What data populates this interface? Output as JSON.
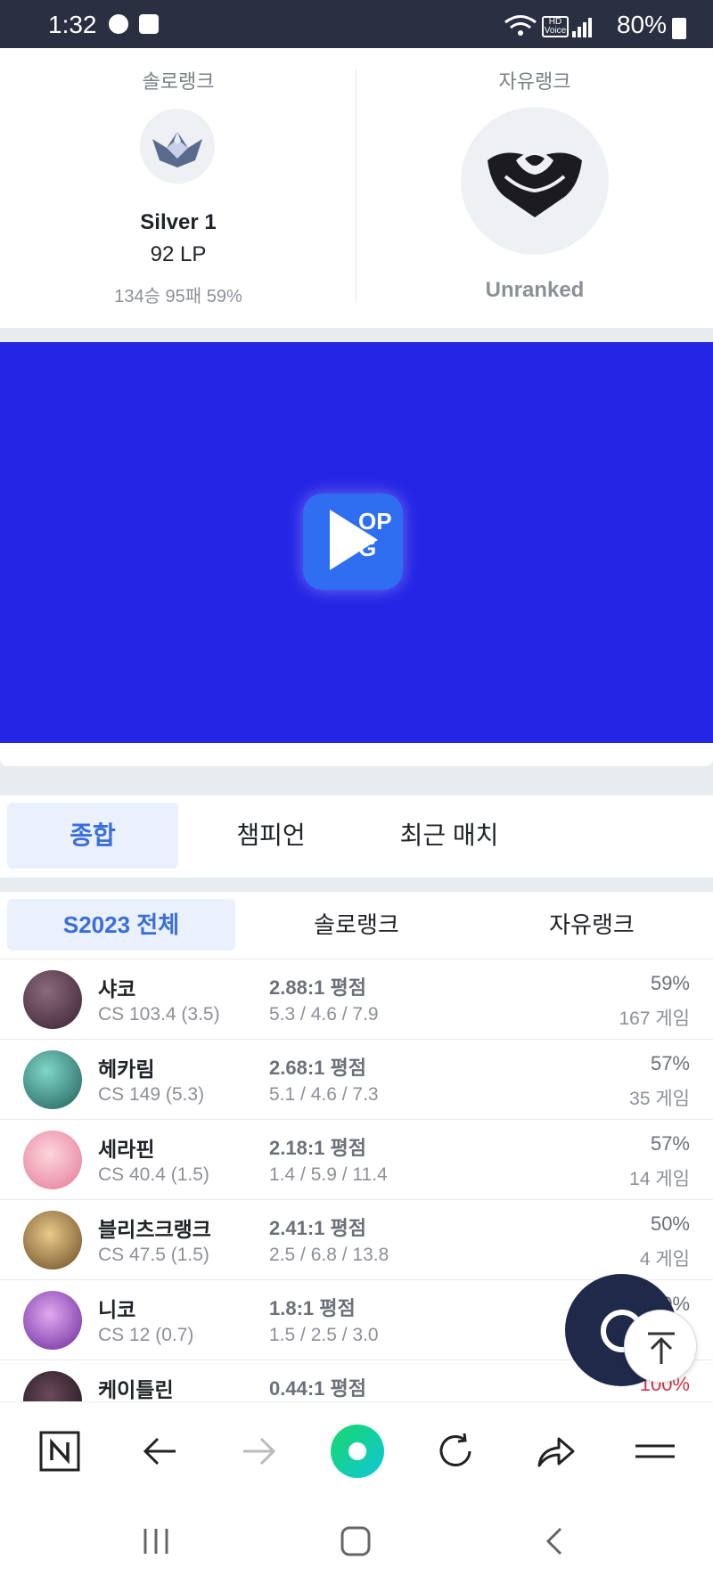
{
  "status_bar": {
    "time": "1:32",
    "battery": "80%",
    "hd_label": "HD Voice"
  },
  "rank": {
    "solo": {
      "title": "솔로랭크",
      "tier": "Silver 1",
      "lp": "92 LP",
      "record": "134승 95패 59%"
    },
    "flex": {
      "title": "자유랭크",
      "tier": "Unranked"
    }
  },
  "ad": {
    "letters": "OP\nG"
  },
  "main_tabs": [
    {
      "label": "종합",
      "active": true
    },
    {
      "label": "챔피언",
      "active": false
    },
    {
      "label": "최근 매치",
      "active": false
    }
  ],
  "season_tabs": [
    {
      "label": "S2023 전체",
      "active": true
    },
    {
      "label": "솔로랭크",
      "active": false
    },
    {
      "label": "자유랭크",
      "active": false
    }
  ],
  "champions": [
    {
      "name": "샤코",
      "cs": "CS 103.4 (3.5)",
      "kda": "2.88:1 평점",
      "avg": "5.3 / 4.6 / 7.9",
      "winrate": "59%",
      "games": "167 게임",
      "color": "#5a3a4c"
    },
    {
      "name": "헤카림",
      "cs": "CS 149 (5.3)",
      "kda": "2.68:1 평점",
      "avg": "5.1 / 4.6 / 7.3",
      "winrate": "57%",
      "games": "35 게임",
      "color": "#2f8a86"
    },
    {
      "name": "세라핀",
      "cs": "CS 40.4 (1.5)",
      "kda": "2.18:1 평점",
      "avg": "1.4 / 5.9 / 11.4",
      "winrate": "57%",
      "games": "14 게임",
      "color": "#f0a2b8"
    },
    {
      "name": "블리츠크랭크",
      "cs": "CS 47.5 (1.5)",
      "kda": "2.41:1 평점",
      "avg": "2.5 / 6.8 / 13.8",
      "winrate": "50%",
      "games": "4 게임",
      "color": "#c49a4a"
    },
    {
      "name": "니코",
      "cs": "CS 12 (0.7)",
      "kda": "1.8:1 평점",
      "avg": "1.5 / 2.5 / 3.0",
      "winrate": "0%",
      "games": "",
      "color": "#9b4fc8"
    },
    {
      "name": "케이틀린",
      "cs": "",
      "kda": "0.44:1 평점",
      "avg": "",
      "winrate": "100%",
      "games": "",
      "color": "#3b2f3a"
    }
  ],
  "colors": {
    "accent": "#3a6fd8",
    "ad_bg": "#2525e6",
    "fab": "#1f2a4a",
    "loss": "#d3324a"
  },
  "icons": [
    "naver-n-icon",
    "back-arrow-icon",
    "forward-arrow-icon",
    "home-dot-icon",
    "refresh-icon",
    "share-icon",
    "menu-icon",
    "recent-apps-icon",
    "home-icon",
    "back-icon",
    "scroll-top-icon"
  ]
}
